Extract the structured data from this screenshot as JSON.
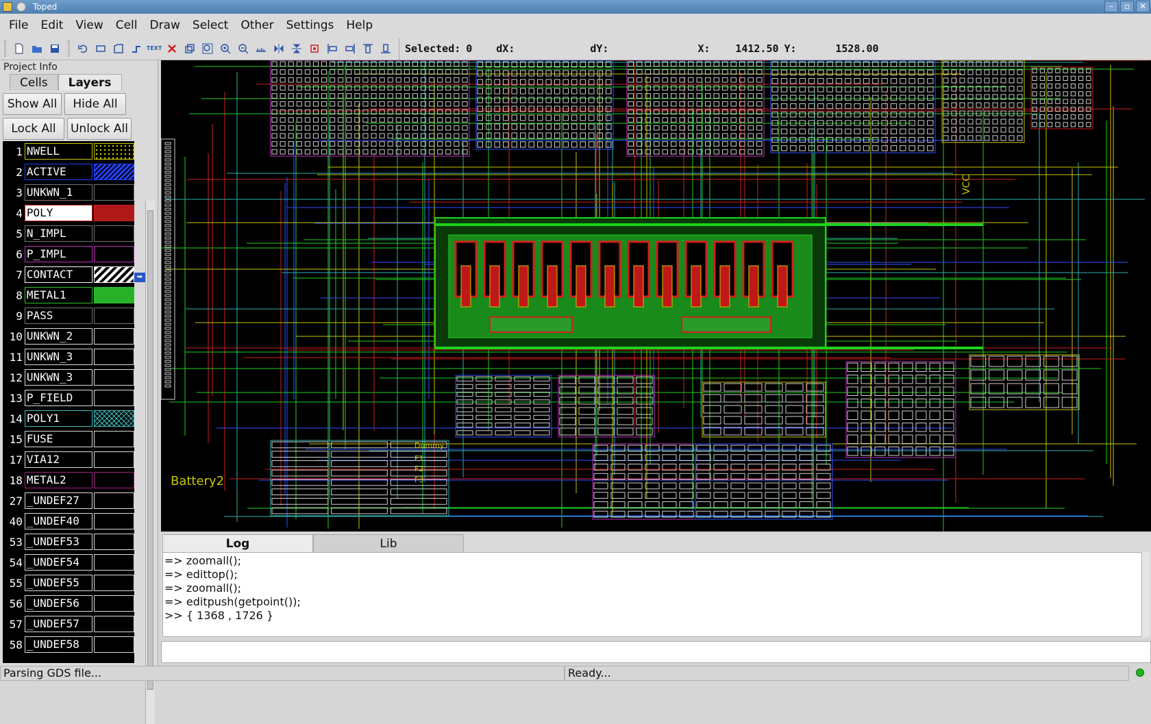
{
  "window": {
    "title": "Toped"
  },
  "menu": [
    "File",
    "Edit",
    "View",
    "Cell",
    "Draw",
    "Select",
    "Other",
    "Settings",
    "Help"
  ],
  "toolbar": {
    "selected_label": "Selected:",
    "selected_value": "0",
    "dx_label": "dX:",
    "dy_label": "dY:",
    "x_label": "X:",
    "x_value": "1412.50",
    "y_label": "Y:",
    "y_value": "1528.00"
  },
  "panel": {
    "title": "Project Info",
    "tabs": [
      "Cells",
      "Layers"
    ],
    "active_tab": "Layers",
    "buttons": {
      "show_all": "Show All",
      "hide_all": "Hide All",
      "lock_all": "Lock All",
      "unlock_all": "Unlock All"
    }
  },
  "layers": [
    {
      "num": "1",
      "name": "NWELL",
      "color": "#c8c800",
      "fill": "dots"
    },
    {
      "num": "2",
      "name": "ACTIVE",
      "color": "#2040ff",
      "fill": "hatch-blue"
    },
    {
      "num": "3",
      "name": "UNKWN_1",
      "color": "#777777",
      "fill": "none"
    },
    {
      "num": "4",
      "name": "POLY",
      "color": "#cc2222",
      "fill": "red",
      "selected": true
    },
    {
      "num": "5",
      "name": "N_IMPL",
      "color": "#777777",
      "fill": "none"
    },
    {
      "num": "6",
      "name": "P_IMPL",
      "color": "#c030c0",
      "fill": "none"
    },
    {
      "num": "7",
      "name": "CONTACT",
      "color": "#ffffff",
      "fill": "stripes"
    },
    {
      "num": "8",
      "name": "METAL1",
      "color": "#30c030",
      "fill": "green"
    },
    {
      "num": "9",
      "name": "PASS",
      "color": "#777777",
      "fill": "none"
    },
    {
      "num": "10",
      "name": "UNKWN_2",
      "color": "#dddddd",
      "fill": "none"
    },
    {
      "num": "11",
      "name": "UNKWN_3",
      "color": "#dddddd",
      "fill": "none"
    },
    {
      "num": "12",
      "name": "UNKWN_3",
      "color": "#dddddd",
      "fill": "none"
    },
    {
      "num": "13",
      "name": "P_FIELD",
      "color": "#dddddd",
      "fill": "none"
    },
    {
      "num": "14",
      "name": "POLY1",
      "color": "#40c0c0",
      "fill": "cross"
    },
    {
      "num": "15",
      "name": "FUSE",
      "color": "#dddddd",
      "fill": "none"
    },
    {
      "num": "17",
      "name": "VIA12",
      "color": "#dddddd",
      "fill": "none"
    },
    {
      "num": "18",
      "name": "METAL2",
      "color": "#a02080",
      "fill": "none"
    },
    {
      "num": "27",
      "name": "_UNDEF27",
      "color": "#dddddd",
      "fill": "none"
    },
    {
      "num": "40",
      "name": "_UNDEF40",
      "color": "#dddddd",
      "fill": "none"
    },
    {
      "num": "53",
      "name": "_UNDEF53",
      "color": "#dddddd",
      "fill": "none"
    },
    {
      "num": "54",
      "name": "_UNDEF54",
      "color": "#dddddd",
      "fill": "none"
    },
    {
      "num": "55",
      "name": "_UNDEF55",
      "color": "#dddddd",
      "fill": "none"
    },
    {
      "num": "56",
      "name": "_UNDEF56",
      "color": "#dddddd",
      "fill": "none"
    },
    {
      "num": "57",
      "name": "_UNDEF57",
      "color": "#dddddd",
      "fill": "none"
    },
    {
      "num": "58",
      "name": "_UNDEF58",
      "color": "#dddddd",
      "fill": "none"
    }
  ],
  "canvas": {
    "labels": [
      "VCC",
      "Battery2",
      "Dummy",
      "F1",
      "F2",
      "F3"
    ]
  },
  "bottom": {
    "tabs": [
      "Log",
      "Lib"
    ],
    "active_tab": "Log",
    "log": [
      "=> zoomall();",
      "=> edittop();",
      "=> zoomall();",
      "=> editpush(getpoint());",
      ">> { 1368 , 1726 }"
    ]
  },
  "status": {
    "left": "Parsing GDS file...",
    "right": "Ready..."
  }
}
